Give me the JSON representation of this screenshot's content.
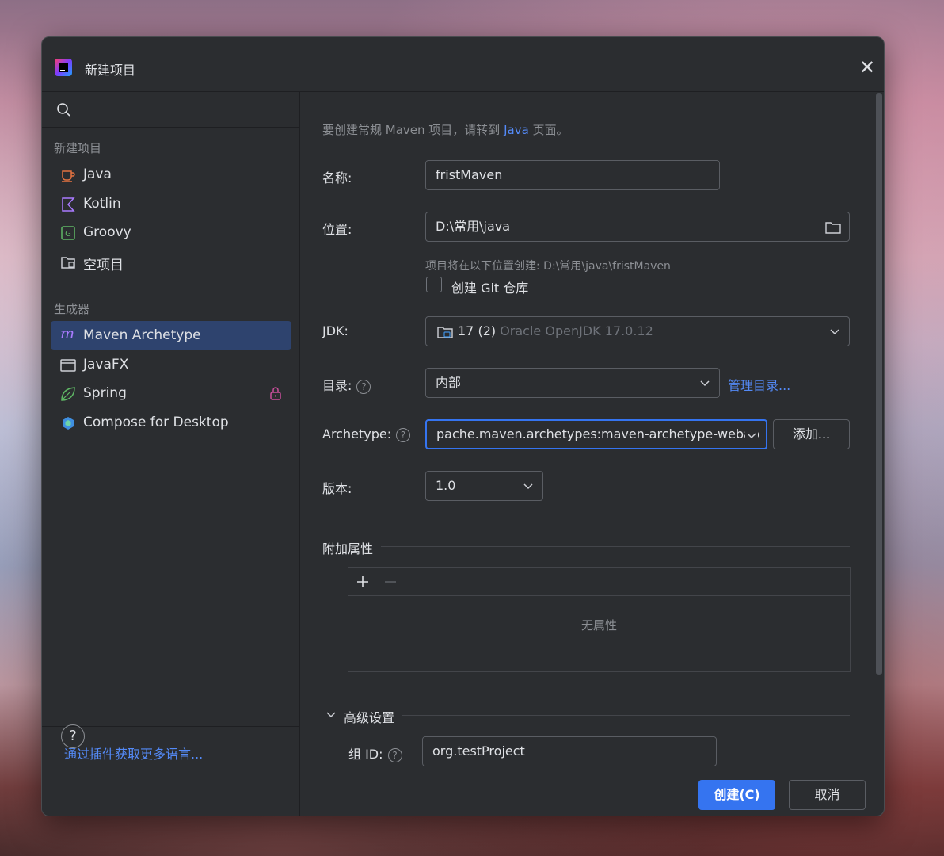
{
  "window": {
    "title": "新建项目"
  },
  "sidebar": {
    "section1": "新建项目",
    "items1": [
      {
        "label": "Java",
        "icon": "java-cup-icon"
      },
      {
        "label": "Kotlin",
        "icon": "kotlin-icon"
      },
      {
        "label": "Groovy",
        "icon": "groovy-icon"
      },
      {
        "label": "空项目",
        "icon": "empty-project-folder-icon"
      }
    ],
    "section2": "生成器",
    "items2": [
      {
        "label": "Maven Archetype",
        "icon": "maven-icon",
        "selected": true
      },
      {
        "label": "JavaFX",
        "icon": "javafx-window-icon"
      },
      {
        "label": "Spring",
        "icon": "spring-leaf-icon",
        "locked": true
      },
      {
        "label": "Compose for Desktop",
        "icon": "compose-icon"
      }
    ],
    "plugins_link": "通过插件获取更多语言..."
  },
  "form": {
    "hint_prefix": "要创建常规 Maven 项目，请转到",
    "hint_link": "Java",
    "hint_suffix": "页面。",
    "name_label": "名称:",
    "name_value": "fristMaven",
    "location_label": "位置:",
    "location_value": "D:\\常用\\java",
    "location_hint": "项目将在以下位置创建: D:\\常用\\java\\fristMaven",
    "git_label": "创建 Git 仓库",
    "jdk_label": "JDK:",
    "jdk_version": "17 (2)",
    "jdk_detail": "Oracle OpenJDK 17.0.12",
    "catalog_label": "目录:",
    "catalog_value": "内部",
    "manage_catalog": "管理目录...",
    "archetype_label": "Archetype:",
    "archetype_value": "pache.maven.archetypes:maven-archetype-webap",
    "add_button": "添加...",
    "version_label": "版本:",
    "version_value": "1.0",
    "props_title": "附加属性",
    "props_empty": "无属性",
    "advanced_title": "高级设置",
    "group_label": "组 ID:",
    "group_value": "org.testProject"
  },
  "footer": {
    "create": "创建(C)",
    "cancel": "取消",
    "help": "?"
  },
  "colors": {
    "accent": "#3574f0",
    "link": "#548af7",
    "bg": "#2b2d30"
  }
}
